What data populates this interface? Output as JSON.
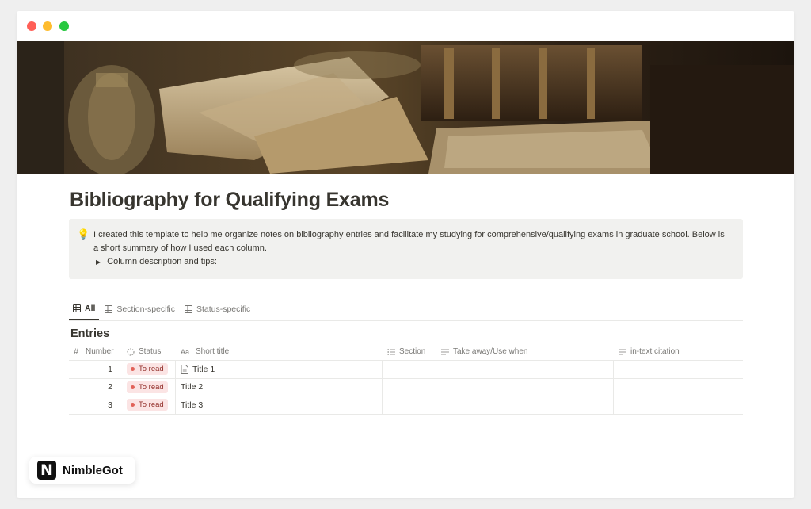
{
  "window": {
    "controls": [
      "close",
      "minimize",
      "maximize"
    ]
  },
  "cover": {
    "description_icon": "cover-image"
  },
  "page": {
    "title": "Bibliography for Qualifying Exams",
    "callout": {
      "icon": "💡",
      "text": "I created this template to help me organize notes on bibliography entries and facilitate my studying for comprehensive/qualifying exams in graduate school. Below is a short summary of how I used each column.",
      "toggle_label": "Column description and tips:"
    }
  },
  "views": {
    "tabs": [
      {
        "label": "All",
        "icon": "table-icon",
        "active": true
      },
      {
        "label": "Section-specific",
        "icon": "table-icon",
        "active": false
      },
      {
        "label": "Status-specific",
        "icon": "table-icon",
        "active": false
      }
    ]
  },
  "database": {
    "title": "Entries",
    "columns": [
      {
        "label": "Number",
        "icon": "hash-icon"
      },
      {
        "label": "Status",
        "icon": "status-icon"
      },
      {
        "label": "Short title",
        "icon": "text-aa-icon"
      },
      {
        "label": "Section",
        "icon": "list-icon"
      },
      {
        "label": "Take away/Use when",
        "icon": "text-lines-icon"
      },
      {
        "label": "in-text citation",
        "icon": "text-lines-icon"
      }
    ],
    "rows": [
      {
        "number": "1",
        "status": "To read",
        "title": "Title 1",
        "has_page_icon": true
      },
      {
        "number": "2",
        "status": "To read",
        "title": "Title 2",
        "has_page_icon": false
      },
      {
        "number": "3",
        "status": "To read",
        "title": "Title 3",
        "has_page_icon": false
      }
    ]
  },
  "brand": {
    "logo_letter": "N",
    "name": "NimbleGot"
  },
  "colors": {
    "status_badge_bg": "#fbe4e4",
    "status_badge_text": "#93302b",
    "status_dot": "#e16259",
    "callout_bg": "#f1f1ef"
  }
}
